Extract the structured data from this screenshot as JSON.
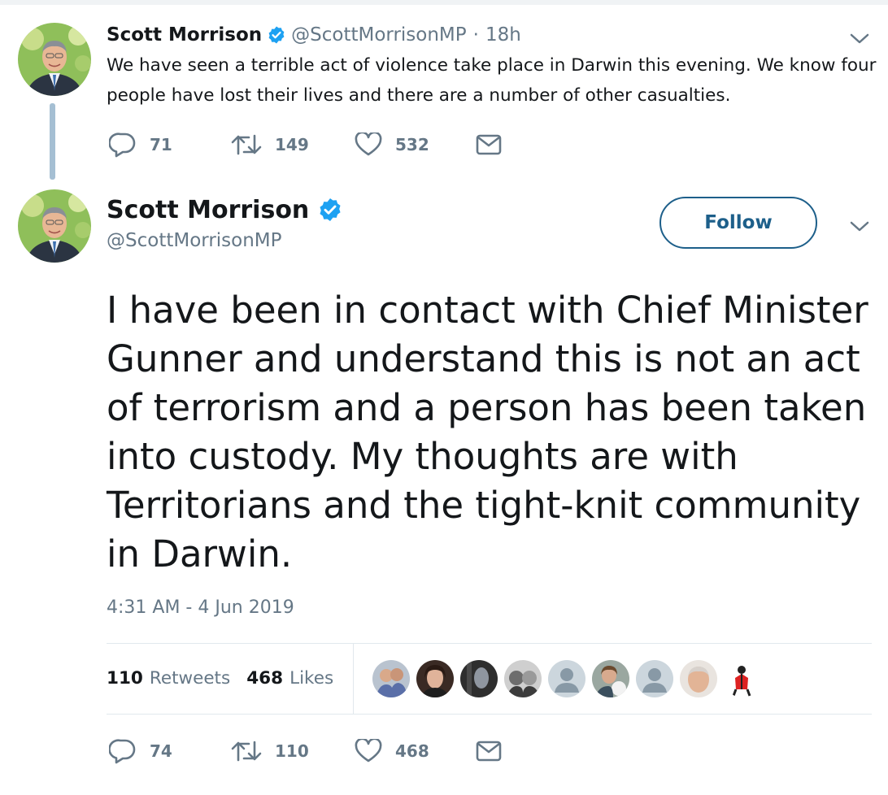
{
  "parent_tweet": {
    "author_name": "Scott Morrison",
    "handle": "@ScottMorrisonMP",
    "separator": "·",
    "time_ago": "18h",
    "text": "We have seen a terrible act of violence take place in Darwin this evening. We know four people have lost their lives and there are a number of other casualties.",
    "replies": "71",
    "retweets": "149",
    "likes": "532"
  },
  "main_tweet": {
    "author_name": "Scott Morrison",
    "handle": "@ScottMorrisonMP",
    "follow_label": "Follow",
    "text": "I have been in contact with Chief Minister Gunner and understand this is not an act of terrorism and a person has been taken into custody. My thoughts are with Territorians and the tight-knit community in Darwin.",
    "timestamp": "4:31 AM - 4 Jun 2019",
    "retweet_count": "110",
    "retweet_label": "Retweets",
    "like_count": "468",
    "like_label": "Likes",
    "replies": "74",
    "retweets": "110",
    "likes": "468"
  },
  "colors": {
    "text_primary": "#14171a",
    "text_secondary": "#657786",
    "verified_blue": "#1da1f2",
    "follow_border": "#1d5f8a",
    "thread_line": "#a5bfd3",
    "divider": "#e1e8ed"
  },
  "icons": [
    "reply-icon",
    "retweet-icon",
    "like-icon",
    "direct-message-icon",
    "verified-badge-icon",
    "chevron-down-icon"
  ]
}
